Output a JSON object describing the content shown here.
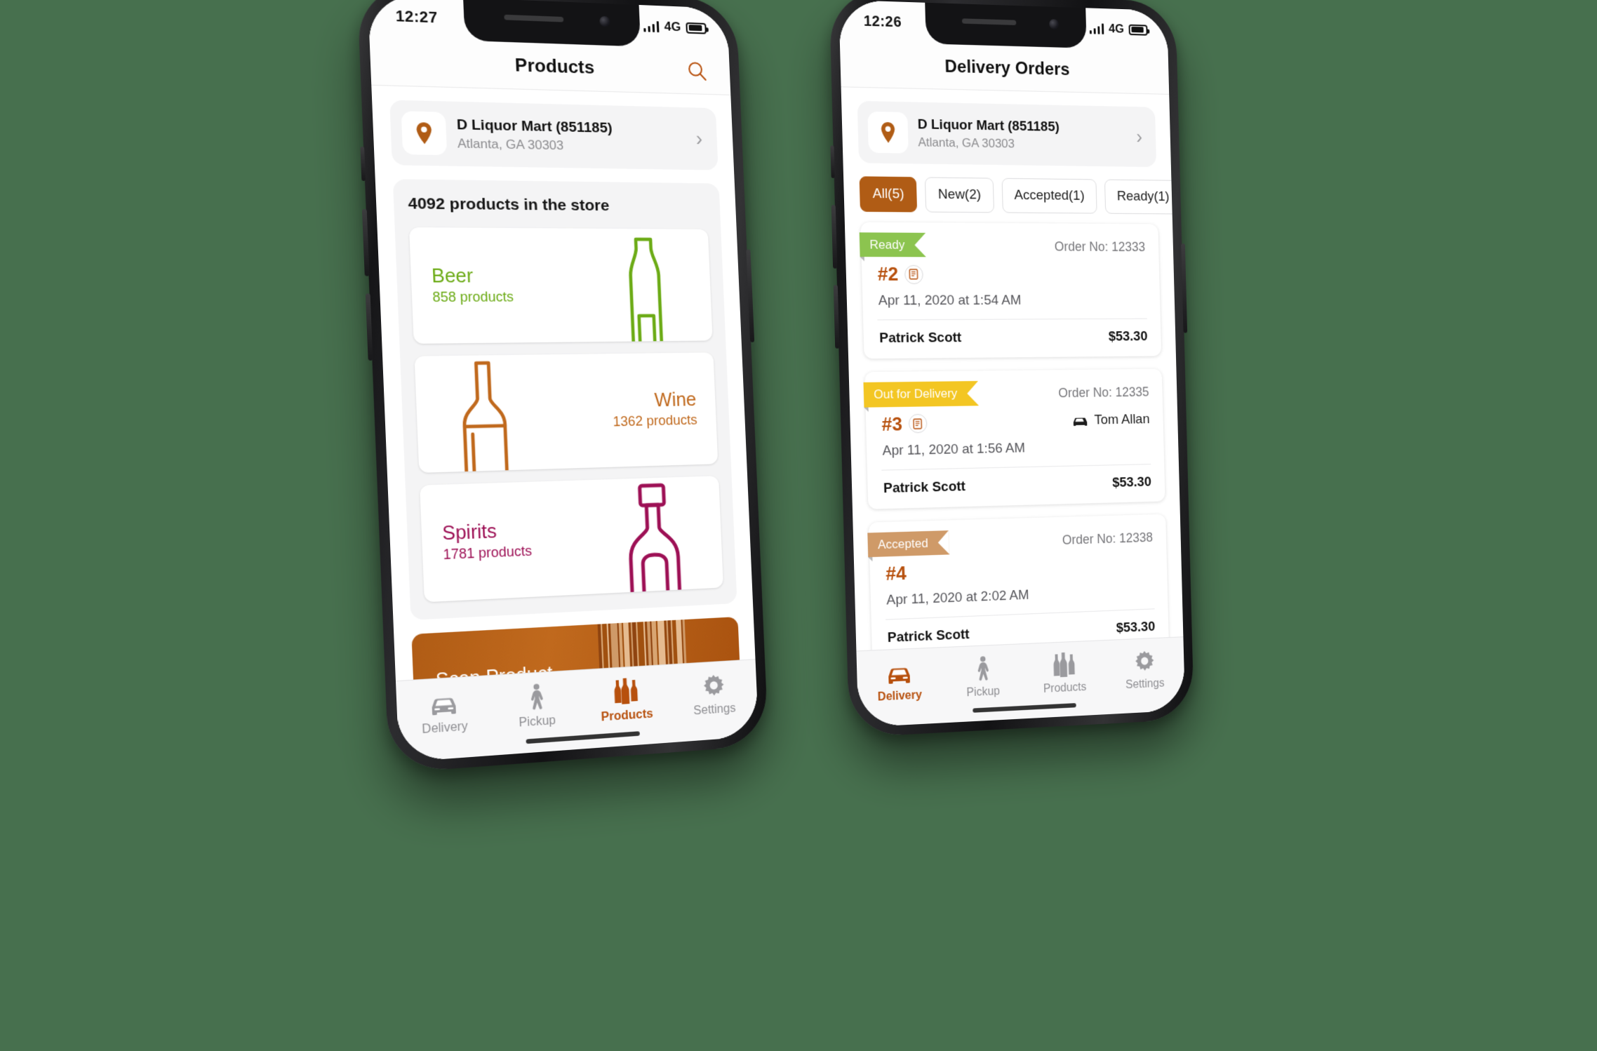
{
  "theme": {
    "background": "#47704e",
    "accent": "#b05c15",
    "accent_text": "#b7500d",
    "beer_color": "#6cab16",
    "wine_color": "#c0691d",
    "spirits_color": "#9d1055"
  },
  "products_phone": {
    "status": {
      "time": "12:27",
      "network": "4G"
    },
    "navbar": {
      "title": "Products",
      "search_icon": "search-icon"
    },
    "store": {
      "icon": "location-pin-icon",
      "name": "D Liquor Mart (851185)",
      "address": "Atlanta, GA 30303",
      "chevron": "chevron-right-icon"
    },
    "panel": {
      "count_label": "4092 products in the store"
    },
    "categories": [
      {
        "name": "Beer",
        "sub": "858 products",
        "color": "#6cab16",
        "align": "left",
        "art": "beer-bottle-icon"
      },
      {
        "name": "Wine",
        "sub": "1362 products",
        "color": "#c0691d",
        "align": "right",
        "art": "wine-bottle-icon"
      },
      {
        "name": "Spirits",
        "sub": "1781 products",
        "color": "#9d1055",
        "align": "left",
        "art": "spirits-bottle-icon"
      }
    ],
    "scan": {
      "label": "Scan Product",
      "icon": "barcode-icon"
    },
    "tabs": [
      {
        "label": "Delivery",
        "icon": "car-icon",
        "active": false
      },
      {
        "label": "Pickup",
        "icon": "walking-icon",
        "active": false
      },
      {
        "label": "Products",
        "icon": "bottles-icon",
        "active": true
      },
      {
        "label": "Settings",
        "icon": "gear-icon",
        "active": false
      }
    ]
  },
  "delivery_phone": {
    "status": {
      "time": "12:26",
      "network": "4G"
    },
    "navbar": {
      "title": "Delivery Orders"
    },
    "store": {
      "icon": "location-pin-icon",
      "name": "D Liquor Mart (851185)",
      "address": "Atlanta, GA 30303",
      "chevron": "chevron-right-icon"
    },
    "filters": [
      {
        "label": "All(5)",
        "active": true
      },
      {
        "label": "New(2)",
        "active": false
      },
      {
        "label": "Accepted(1)",
        "active": false
      },
      {
        "label": "Ready(1)",
        "active": false
      },
      {
        "label": "",
        "active": false
      }
    ],
    "orders": [
      {
        "status": "Ready",
        "status_color": "#8cc44f",
        "order_no_label": "Order No: 12333",
        "number": "#2",
        "has_doc_icon": true,
        "driver": "",
        "date": "Apr 11, 2020 at 1:54 AM",
        "customer": "Patrick Scott",
        "amount": "$53.30"
      },
      {
        "status": "Out for Delivery",
        "status_color": "#f3c623",
        "order_no_label": "Order No: 12335",
        "number": "#3",
        "has_doc_icon": true,
        "driver": "Tom Allan",
        "date": "Apr 11, 2020 at 1:56 AM",
        "customer": "Patrick Scott",
        "amount": "$53.30"
      },
      {
        "status": "Accepted",
        "status_color": "#cf9a68",
        "order_no_label": "Order No: 12338",
        "number": "#4",
        "has_doc_icon": false,
        "driver": "",
        "date": "Apr 11, 2020 at 2:02 AM",
        "customer": "Patrick Scott",
        "amount": "$53.30"
      }
    ],
    "tabs": [
      {
        "label": "Delivery",
        "icon": "car-icon",
        "active": true
      },
      {
        "label": "Pickup",
        "icon": "walking-icon",
        "active": false
      },
      {
        "label": "Products",
        "icon": "bottles-icon",
        "active": false
      },
      {
        "label": "Settings",
        "icon": "gear-icon",
        "active": false
      }
    ]
  }
}
